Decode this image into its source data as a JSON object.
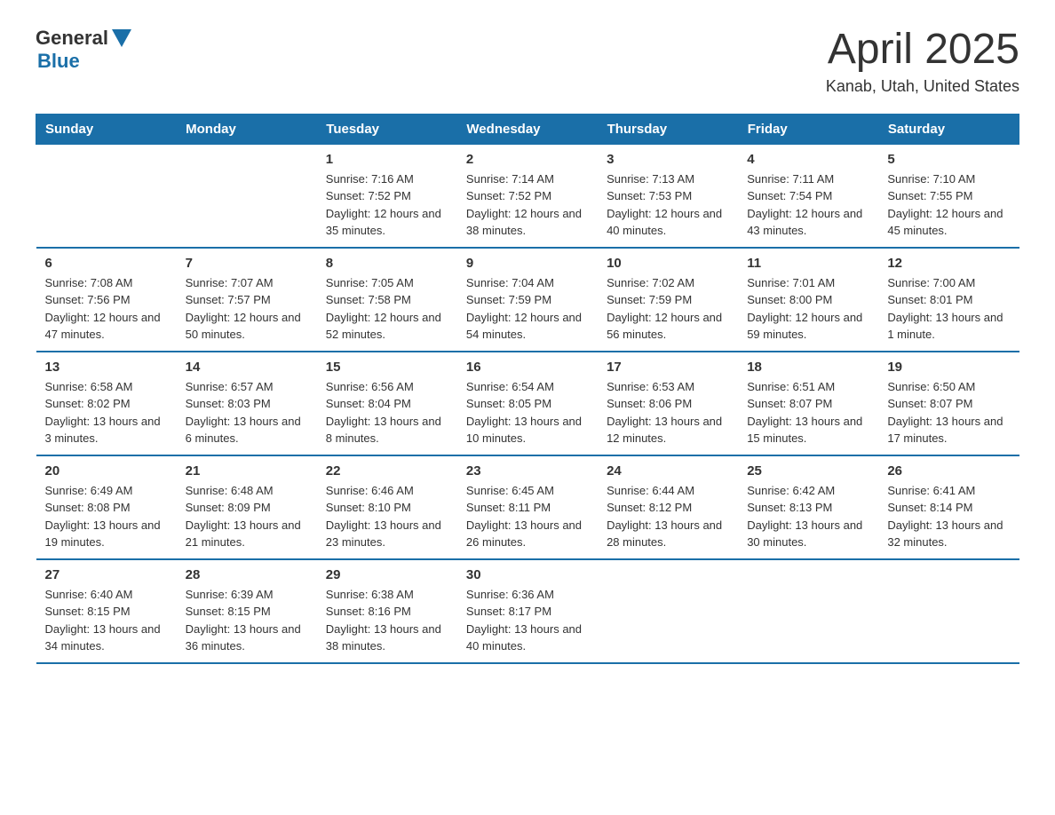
{
  "logo": {
    "general": "General",
    "blue": "Blue"
  },
  "title": {
    "month_year": "April 2025",
    "location": "Kanab, Utah, United States"
  },
  "days_of_week": [
    "Sunday",
    "Monday",
    "Tuesday",
    "Wednesday",
    "Thursday",
    "Friday",
    "Saturday"
  ],
  "weeks": [
    [
      {
        "day": "",
        "sunrise": "",
        "sunset": "",
        "daylight": ""
      },
      {
        "day": "",
        "sunrise": "",
        "sunset": "",
        "daylight": ""
      },
      {
        "day": "1",
        "sunrise": "Sunrise: 7:16 AM",
        "sunset": "Sunset: 7:52 PM",
        "daylight": "Daylight: 12 hours and 35 minutes."
      },
      {
        "day": "2",
        "sunrise": "Sunrise: 7:14 AM",
        "sunset": "Sunset: 7:52 PM",
        "daylight": "Daylight: 12 hours and 38 minutes."
      },
      {
        "day": "3",
        "sunrise": "Sunrise: 7:13 AM",
        "sunset": "Sunset: 7:53 PM",
        "daylight": "Daylight: 12 hours and 40 minutes."
      },
      {
        "day": "4",
        "sunrise": "Sunrise: 7:11 AM",
        "sunset": "Sunset: 7:54 PM",
        "daylight": "Daylight: 12 hours and 43 minutes."
      },
      {
        "day": "5",
        "sunrise": "Sunrise: 7:10 AM",
        "sunset": "Sunset: 7:55 PM",
        "daylight": "Daylight: 12 hours and 45 minutes."
      }
    ],
    [
      {
        "day": "6",
        "sunrise": "Sunrise: 7:08 AM",
        "sunset": "Sunset: 7:56 PM",
        "daylight": "Daylight: 12 hours and 47 minutes."
      },
      {
        "day": "7",
        "sunrise": "Sunrise: 7:07 AM",
        "sunset": "Sunset: 7:57 PM",
        "daylight": "Daylight: 12 hours and 50 minutes."
      },
      {
        "day": "8",
        "sunrise": "Sunrise: 7:05 AM",
        "sunset": "Sunset: 7:58 PM",
        "daylight": "Daylight: 12 hours and 52 minutes."
      },
      {
        "day": "9",
        "sunrise": "Sunrise: 7:04 AM",
        "sunset": "Sunset: 7:59 PM",
        "daylight": "Daylight: 12 hours and 54 minutes."
      },
      {
        "day": "10",
        "sunrise": "Sunrise: 7:02 AM",
        "sunset": "Sunset: 7:59 PM",
        "daylight": "Daylight: 12 hours and 56 minutes."
      },
      {
        "day": "11",
        "sunrise": "Sunrise: 7:01 AM",
        "sunset": "Sunset: 8:00 PM",
        "daylight": "Daylight: 12 hours and 59 minutes."
      },
      {
        "day": "12",
        "sunrise": "Sunrise: 7:00 AM",
        "sunset": "Sunset: 8:01 PM",
        "daylight": "Daylight: 13 hours and 1 minute."
      }
    ],
    [
      {
        "day": "13",
        "sunrise": "Sunrise: 6:58 AM",
        "sunset": "Sunset: 8:02 PM",
        "daylight": "Daylight: 13 hours and 3 minutes."
      },
      {
        "day": "14",
        "sunrise": "Sunrise: 6:57 AM",
        "sunset": "Sunset: 8:03 PM",
        "daylight": "Daylight: 13 hours and 6 minutes."
      },
      {
        "day": "15",
        "sunrise": "Sunrise: 6:56 AM",
        "sunset": "Sunset: 8:04 PM",
        "daylight": "Daylight: 13 hours and 8 minutes."
      },
      {
        "day": "16",
        "sunrise": "Sunrise: 6:54 AM",
        "sunset": "Sunset: 8:05 PM",
        "daylight": "Daylight: 13 hours and 10 minutes."
      },
      {
        "day": "17",
        "sunrise": "Sunrise: 6:53 AM",
        "sunset": "Sunset: 8:06 PM",
        "daylight": "Daylight: 13 hours and 12 minutes."
      },
      {
        "day": "18",
        "sunrise": "Sunrise: 6:51 AM",
        "sunset": "Sunset: 8:07 PM",
        "daylight": "Daylight: 13 hours and 15 minutes."
      },
      {
        "day": "19",
        "sunrise": "Sunrise: 6:50 AM",
        "sunset": "Sunset: 8:07 PM",
        "daylight": "Daylight: 13 hours and 17 minutes."
      }
    ],
    [
      {
        "day": "20",
        "sunrise": "Sunrise: 6:49 AM",
        "sunset": "Sunset: 8:08 PM",
        "daylight": "Daylight: 13 hours and 19 minutes."
      },
      {
        "day": "21",
        "sunrise": "Sunrise: 6:48 AM",
        "sunset": "Sunset: 8:09 PM",
        "daylight": "Daylight: 13 hours and 21 minutes."
      },
      {
        "day": "22",
        "sunrise": "Sunrise: 6:46 AM",
        "sunset": "Sunset: 8:10 PM",
        "daylight": "Daylight: 13 hours and 23 minutes."
      },
      {
        "day": "23",
        "sunrise": "Sunrise: 6:45 AM",
        "sunset": "Sunset: 8:11 PM",
        "daylight": "Daylight: 13 hours and 26 minutes."
      },
      {
        "day": "24",
        "sunrise": "Sunrise: 6:44 AM",
        "sunset": "Sunset: 8:12 PM",
        "daylight": "Daylight: 13 hours and 28 minutes."
      },
      {
        "day": "25",
        "sunrise": "Sunrise: 6:42 AM",
        "sunset": "Sunset: 8:13 PM",
        "daylight": "Daylight: 13 hours and 30 minutes."
      },
      {
        "day": "26",
        "sunrise": "Sunrise: 6:41 AM",
        "sunset": "Sunset: 8:14 PM",
        "daylight": "Daylight: 13 hours and 32 minutes."
      }
    ],
    [
      {
        "day": "27",
        "sunrise": "Sunrise: 6:40 AM",
        "sunset": "Sunset: 8:15 PM",
        "daylight": "Daylight: 13 hours and 34 minutes."
      },
      {
        "day": "28",
        "sunrise": "Sunrise: 6:39 AM",
        "sunset": "Sunset: 8:15 PM",
        "daylight": "Daylight: 13 hours and 36 minutes."
      },
      {
        "day": "29",
        "sunrise": "Sunrise: 6:38 AM",
        "sunset": "Sunset: 8:16 PM",
        "daylight": "Daylight: 13 hours and 38 minutes."
      },
      {
        "day": "30",
        "sunrise": "Sunrise: 6:36 AM",
        "sunset": "Sunset: 8:17 PM",
        "daylight": "Daylight: 13 hours and 40 minutes."
      },
      {
        "day": "",
        "sunrise": "",
        "sunset": "",
        "daylight": ""
      },
      {
        "day": "",
        "sunrise": "",
        "sunset": "",
        "daylight": ""
      },
      {
        "day": "",
        "sunrise": "",
        "sunset": "",
        "daylight": ""
      }
    ]
  ]
}
